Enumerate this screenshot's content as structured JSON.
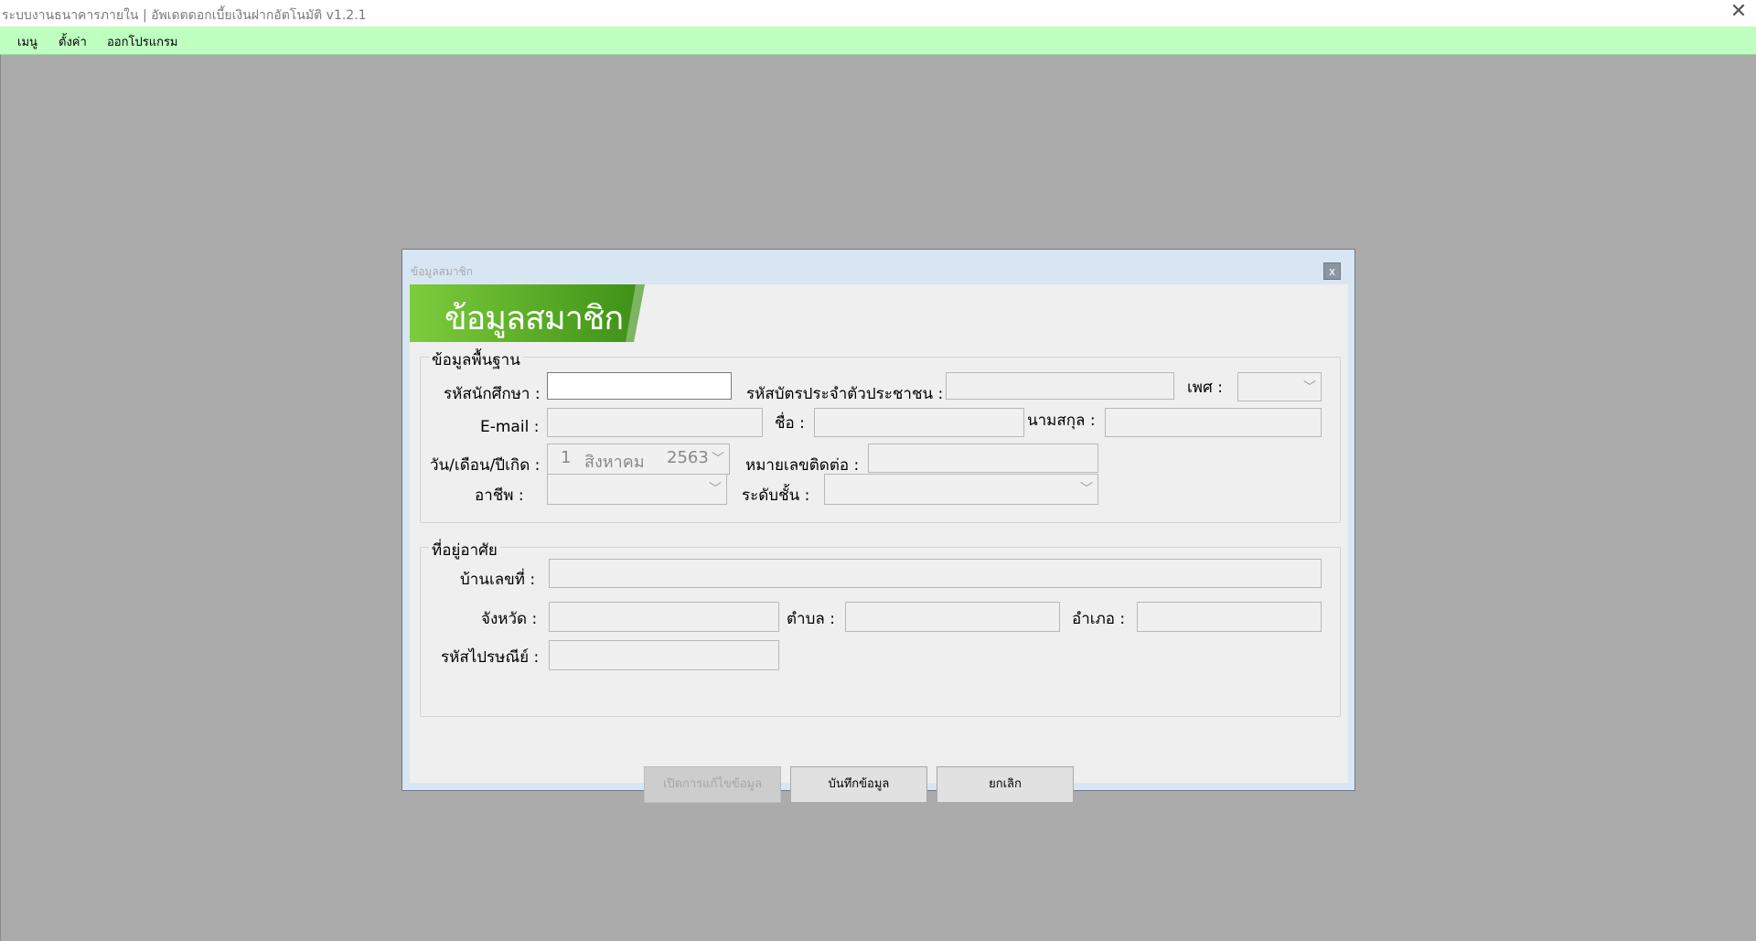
{
  "app": {
    "title": "ระบบงานธนาคารภายใน | อัพเดตดอกเบี้ยเงินฝากอัตโนมัติ   v1.2.1",
    "close_glyph": "✕"
  },
  "menu": {
    "items": [
      {
        "label": "เมนู"
      },
      {
        "label": "ตั้งค่า"
      },
      {
        "label": "ออกโปรแกรม"
      }
    ]
  },
  "dialog": {
    "caption": "ข้อมูลสมาชิก",
    "close_glyph": "x",
    "banner_title": "ข้อมูลสมาชิก",
    "banner_colors": {
      "light": "#7ccd3c",
      "dark": "#3d8f16"
    },
    "basic": {
      "title": "ข้อมูลพื้นฐาน",
      "student_id_label": "รหัสนักศึกษา :",
      "citizen_id_label": "รหัสบัตรประจำตัวประชาชน :",
      "gender_label": "เพศ :",
      "email_label": "E-mail :",
      "first_name_label": "ชื่อ :",
      "last_name_label": "นามสกุล :",
      "birthdate_label": "วัน/เดือน/ปีเกิด :",
      "birthdate": {
        "day": "1",
        "month": "สิงหาคม",
        "year": "2563"
      },
      "phone_label": "หมายเลขติดต่อ :",
      "occupation_label": "อาชีพ :",
      "level_label": "ระดับชั้น :"
    },
    "address": {
      "title": "ที่อยู่อาศัย",
      "house_no_label": "บ้านเลขที่ :",
      "province_label": "จังหวัด :",
      "subdistrict_label": "ตำบล :",
      "district_label": "อำเภอ :",
      "postal_label": "รหัสไปรษณีย์ :"
    },
    "buttons": {
      "enable_edit": "เปิดการแก้ไขข้อมูล",
      "save": "บันทึกข้อมูล",
      "cancel": "ยกเลิก"
    }
  }
}
